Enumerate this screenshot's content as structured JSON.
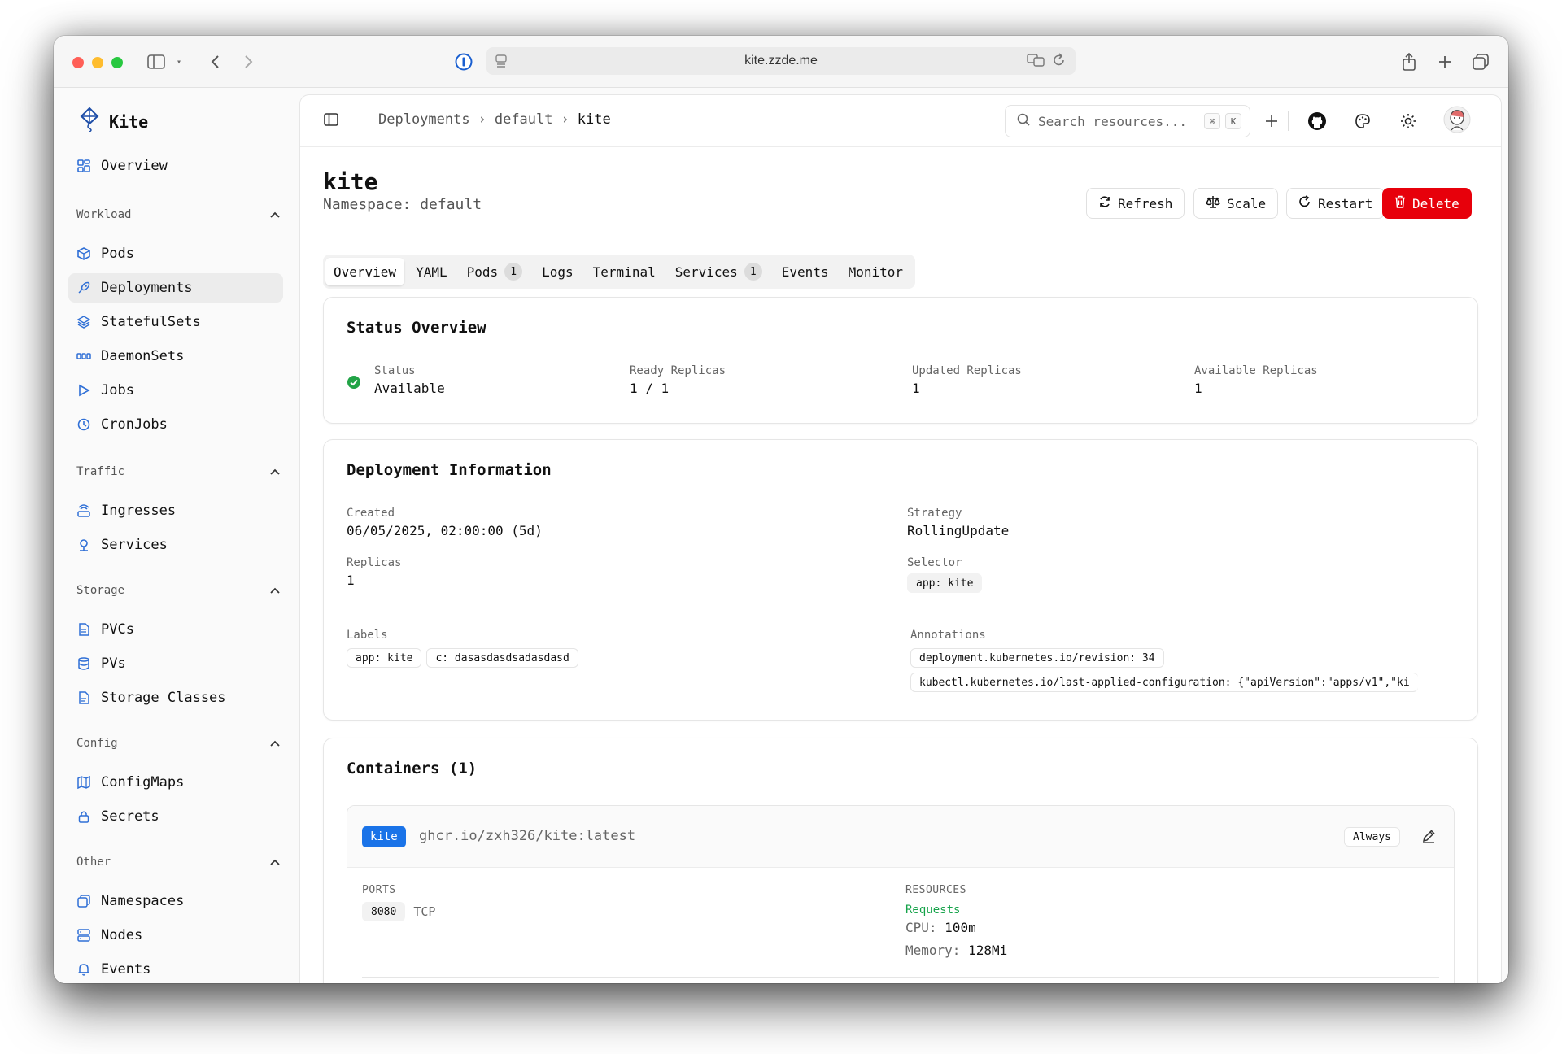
{
  "browser": {
    "url": "kite.zzde.me"
  },
  "sidebar": {
    "brand": "Kite",
    "overview": "Overview",
    "sections": [
      {
        "title": "Workload",
        "items": [
          "Pods",
          "Deployments",
          "StatefulSets",
          "DaemonSets",
          "Jobs",
          "CronJobs"
        ]
      },
      {
        "title": "Traffic",
        "items": [
          "Ingresses",
          "Services"
        ]
      },
      {
        "title": "Storage",
        "items": [
          "PVCs",
          "PVs",
          "Storage Classes"
        ]
      },
      {
        "title": "Config",
        "items": [
          "ConfigMaps",
          "Secrets"
        ]
      },
      {
        "title": "Other",
        "items": [
          "Namespaces",
          "Nodes",
          "Events"
        ]
      }
    ],
    "active_item": "Deployments"
  },
  "topbar": {
    "breadcrumbs": [
      "Deployments",
      "default",
      "kite"
    ],
    "search_placeholder": "Search resources...",
    "kbd_cmd": "⌘",
    "kbd_k": "K"
  },
  "header": {
    "title": "kite",
    "subtitle": "Namespace: default",
    "buttons": {
      "refresh": "Refresh",
      "scale": "Scale",
      "restart": "Restart",
      "delete": "Delete"
    }
  },
  "tabs": [
    {
      "label": "Overview"
    },
    {
      "label": "YAML"
    },
    {
      "label": "Pods",
      "count": "1"
    },
    {
      "label": "Logs"
    },
    {
      "label": "Terminal"
    },
    {
      "label": "Services",
      "count": "1"
    },
    {
      "label": "Events"
    },
    {
      "label": "Monitor"
    }
  ],
  "status_overview": {
    "title": "Status Overview",
    "fields": [
      {
        "label": "Status",
        "value": "Available"
      },
      {
        "label": "Ready Replicas",
        "value": "1 / 1"
      },
      {
        "label": "Updated Replicas",
        "value": "1"
      },
      {
        "label": "Available Replicas",
        "value": "1"
      }
    ]
  },
  "deployment_info": {
    "title": "Deployment Information",
    "created_label": "Created",
    "created_value": "06/05/2025, 02:00:00 (5d)",
    "strategy_label": "Strategy",
    "strategy_value": "RollingUpdate",
    "replicas_label": "Replicas",
    "replicas_value": "1",
    "selector_label": "Selector",
    "selector_value": "app: kite",
    "labels_label": "Labels",
    "labels": [
      "app: kite",
      "c: dasasdasdsadasdasd"
    ],
    "annotations_label": "Annotations",
    "annotations": [
      "deployment.kubernetes.io/revision: 34",
      "kubectl.kubernetes.io/last-applied-configuration: {\"apiVersion\":\"apps/v1\",\"ki"
    ]
  },
  "containers": {
    "title": "Containers (1)",
    "name": "kite",
    "image": "ghcr.io/zxh326/kite:latest",
    "pull_policy": "Always",
    "ports_label": "PORTS",
    "port": "8080",
    "protocol": "TCP",
    "resources_label": "RESOURCES",
    "requests_label": "Requests",
    "cpu_label": "CPU:",
    "cpu_value": "100m",
    "memory_label": "Memory:",
    "memory_value": "128Mi"
  },
  "colors": {
    "accent": "#2f6fd6",
    "danger": "#e7000b",
    "success": "#22a447",
    "requests_green": "#16a34a",
    "badge_blue": "#1a73e8"
  }
}
